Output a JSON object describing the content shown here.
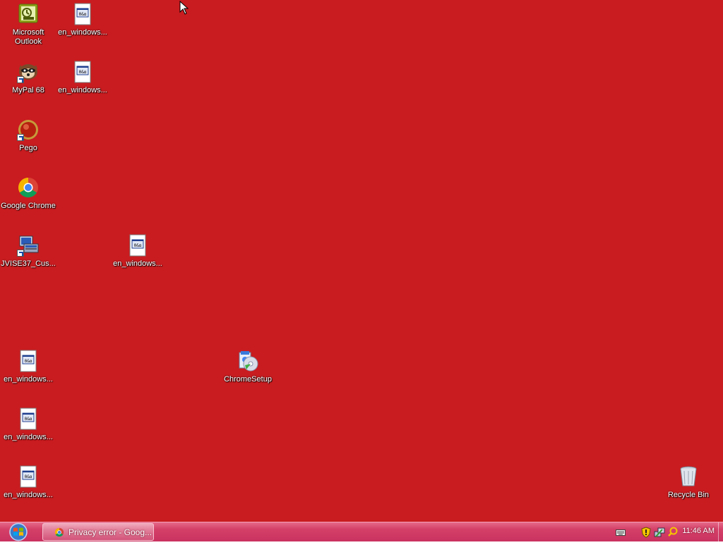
{
  "desktop": {
    "background_color": "#c91c20",
    "icons": [
      {
        "label": "Microsoft Outlook",
        "icon": "outlook-icon"
      },
      {
        "label": "en_windows...",
        "icon": "document-icon"
      },
      {
        "label": "MyPal 68",
        "icon": "mypal-icon"
      },
      {
        "label": "en_windows...",
        "icon": "document-icon"
      },
      {
        "label": "Pego",
        "icon": "pego-icon"
      },
      {
        "label": "Google Chrome",
        "icon": "chrome-icon"
      },
      {
        "label": "JVISE37_Cus...",
        "icon": "installer-icon"
      },
      {
        "label": "en_windows...",
        "icon": "document-icon"
      },
      {
        "label": "en_windows...",
        "icon": "document-icon"
      },
      {
        "label": "ChromeSetup",
        "icon": "setup-icon"
      },
      {
        "label": "en_windows...",
        "icon": "document-icon"
      },
      {
        "label": "en_windows...",
        "icon": "document-icon"
      },
      {
        "label": "Recycle Bin",
        "icon": "recycle-bin-icon"
      }
    ]
  },
  "taskbar": {
    "start_icon": "windows-start-icon",
    "task_label": "Privacy error - Goog...",
    "task_icon": "chrome-icon",
    "tray_icons": [
      "keyboard-icon",
      "security-shield-icon",
      "network-icon",
      "search-icon"
    ],
    "clock": "11:46 AM",
    "accent_color": "#d44068"
  }
}
